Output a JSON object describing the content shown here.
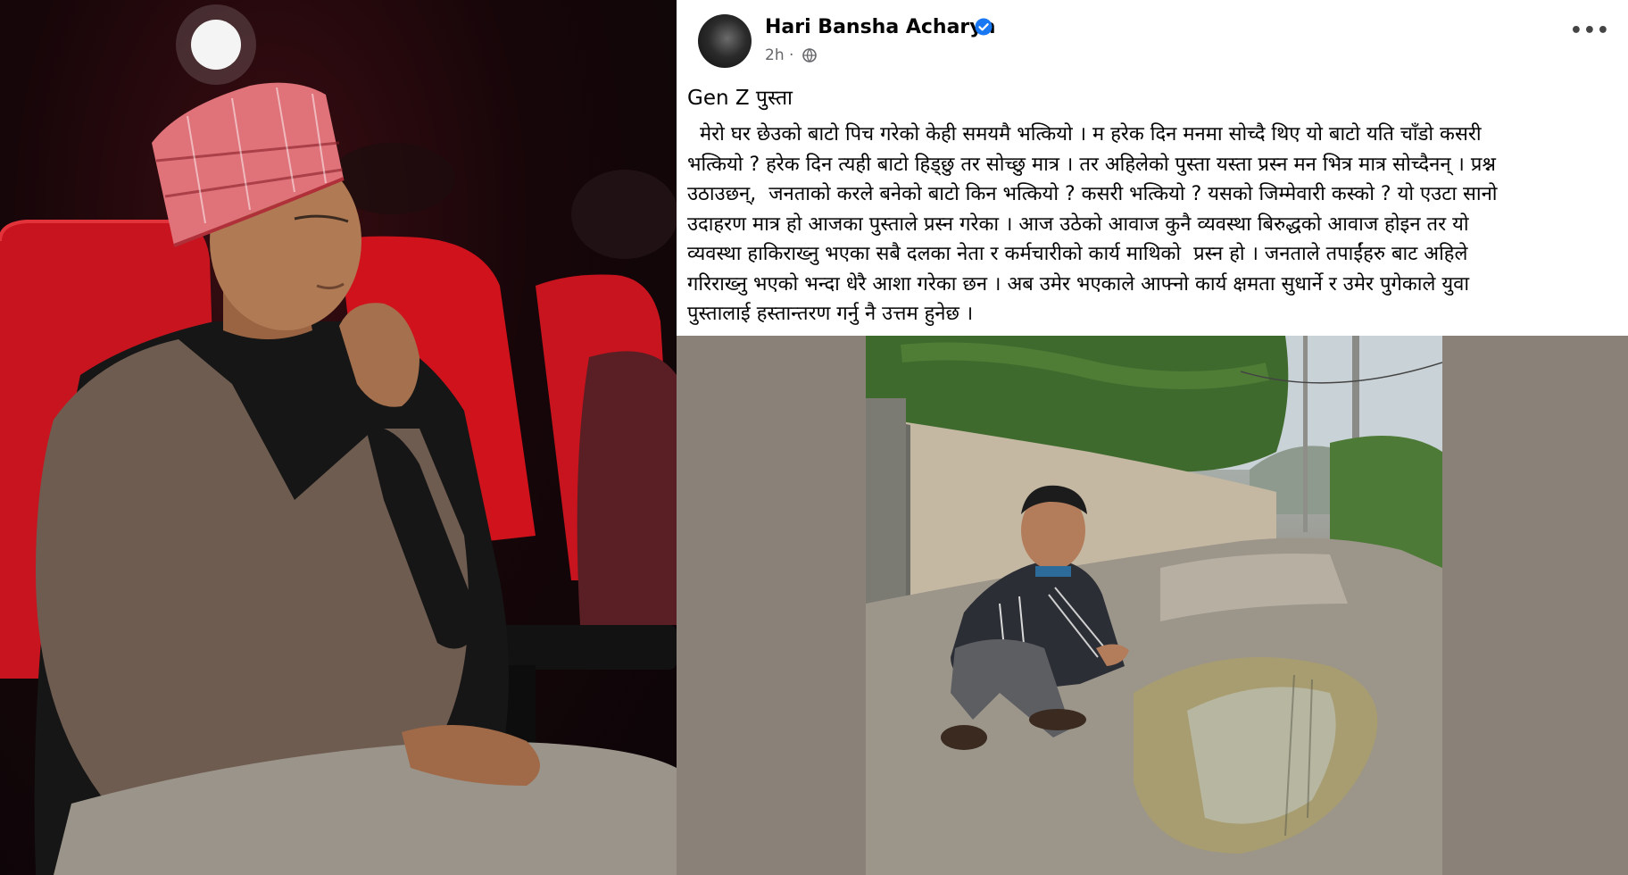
{
  "post": {
    "author": "Hari Bansha Acharya",
    "verified": true,
    "time": "2h",
    "title": "Gen Z  पुस्ता",
    "body": "  मेरो घर छेउको बाटो पिच गरेको केही समयमै भत्कियो । म हरेक दिन मनमा सोच्दै थिए यो बाटो यति चाँडो कसरी\nभत्कियो ? हरेक दिन त्यही बाटो हिड्छु तर सोच्छु मात्र । तर अहिलेको पुस्ता यस्ता प्रस्न मन भित्र मात्र सोच्दैनन् । प्रश्न\nउठाउछन्,  जनताको करले बनेको बाटो किन भत्कियो ? कसरी भत्कियो ? यसको जिम्मेवारी कस्को ? यो एउटा सानो\nउदाहरण मात्र हो आजका पुस्ताले प्रस्न गरेका । आज उठेको आवाज कुनै व्यवस्था बिरुद्धको आवाज होइन तर यो\nव्यवस्था हाकिराख्नु भएका सबै दलका नेता र कर्मचारीको कार्य माथिको  प्रस्न हो । जनताले तपाईंहरु बाट अहिले\nगरिराख्नु भएको भन्दा धेरै आशा गरेका छन । अब उमेर भएकाले आफ्नो कार्य क्षमता सुधार्ने र उमेर पुगेकाले युवा\nपुस्तालाई हस्तान्तरण गर्नु नै उत्तम हुनेछ ।"
  },
  "icons": {
    "verified": "verified-badge-icon",
    "audience": "globe-icon",
    "more": "more-options-icon"
  },
  "colors": {
    "verified_blue": "#1877f2",
    "meta_gray": "#65676b",
    "seat_red": "#c8141e",
    "frame_bg": "#8a8279"
  }
}
